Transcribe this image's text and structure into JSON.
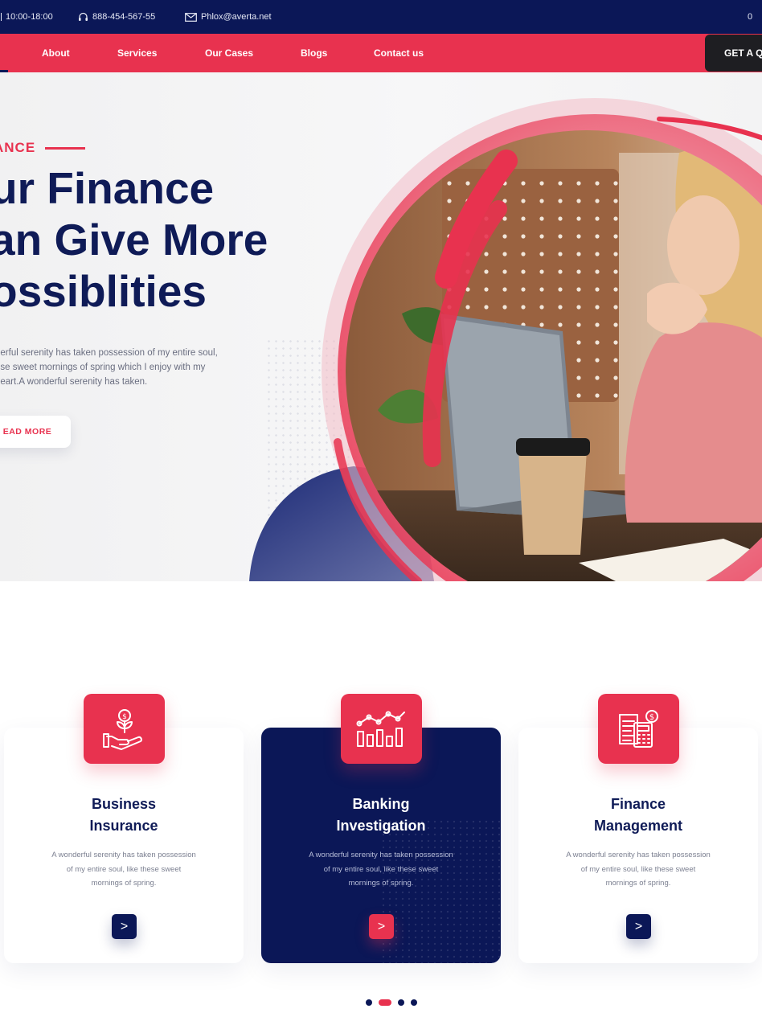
{
  "topbar": {
    "hours": "10:00-18:00",
    "phone": "888-454-567-55",
    "email": "Phlox@averta.net",
    "cart_count": "0",
    "icons": [
      "clock-icon",
      "headset-icon",
      "mail-icon"
    ]
  },
  "nav": {
    "items": [
      "About",
      "Services",
      "Our Cases",
      "Blogs",
      "Contact us"
    ],
    "cta": "GET A Q"
  },
  "hero": {
    "eyebrow": "ANCE",
    "headline": [
      "ur Finance",
      "an Give More",
      "ossiblities"
    ],
    "body": [
      "derful serenity has taken possession of my entire soul,",
      "ese sweet mornings of spring which I enjoy with my",
      "heart.A wonderful serenity has taken."
    ],
    "button": "EAD MORE"
  },
  "services": [
    {
      "title": [
        "Business",
        "Insurance"
      ],
      "text": [
        "A wonderful serenity has taken possession",
        "of my entire soul, like these sweet",
        "mornings of spring."
      ],
      "icon": "money-plant-hand-icon",
      "button": ">",
      "featured": false
    },
    {
      "title": [
        "Banking",
        "Investigation"
      ],
      "text": [
        "A wonderful serenity has taken possession",
        "of my entire soul, like these sweet",
        "mornings of spring."
      ],
      "icon": "bar-chart-trend-icon",
      "button": ">",
      "featured": true
    },
    {
      "title": [
        "Finance",
        "Management"
      ],
      "text": [
        "A wonderful serenity has taken possession",
        "of my entire soul, like these sweet",
        "mornings of spring."
      ],
      "icon": "calculator-invoice-icon",
      "button": ">",
      "featured": false
    }
  ],
  "pager": {
    "count": 4,
    "active": 1
  },
  "colors": {
    "navy": "#0b1757",
    "accent": "#e8324f",
    "dark": "#1e1e22"
  }
}
